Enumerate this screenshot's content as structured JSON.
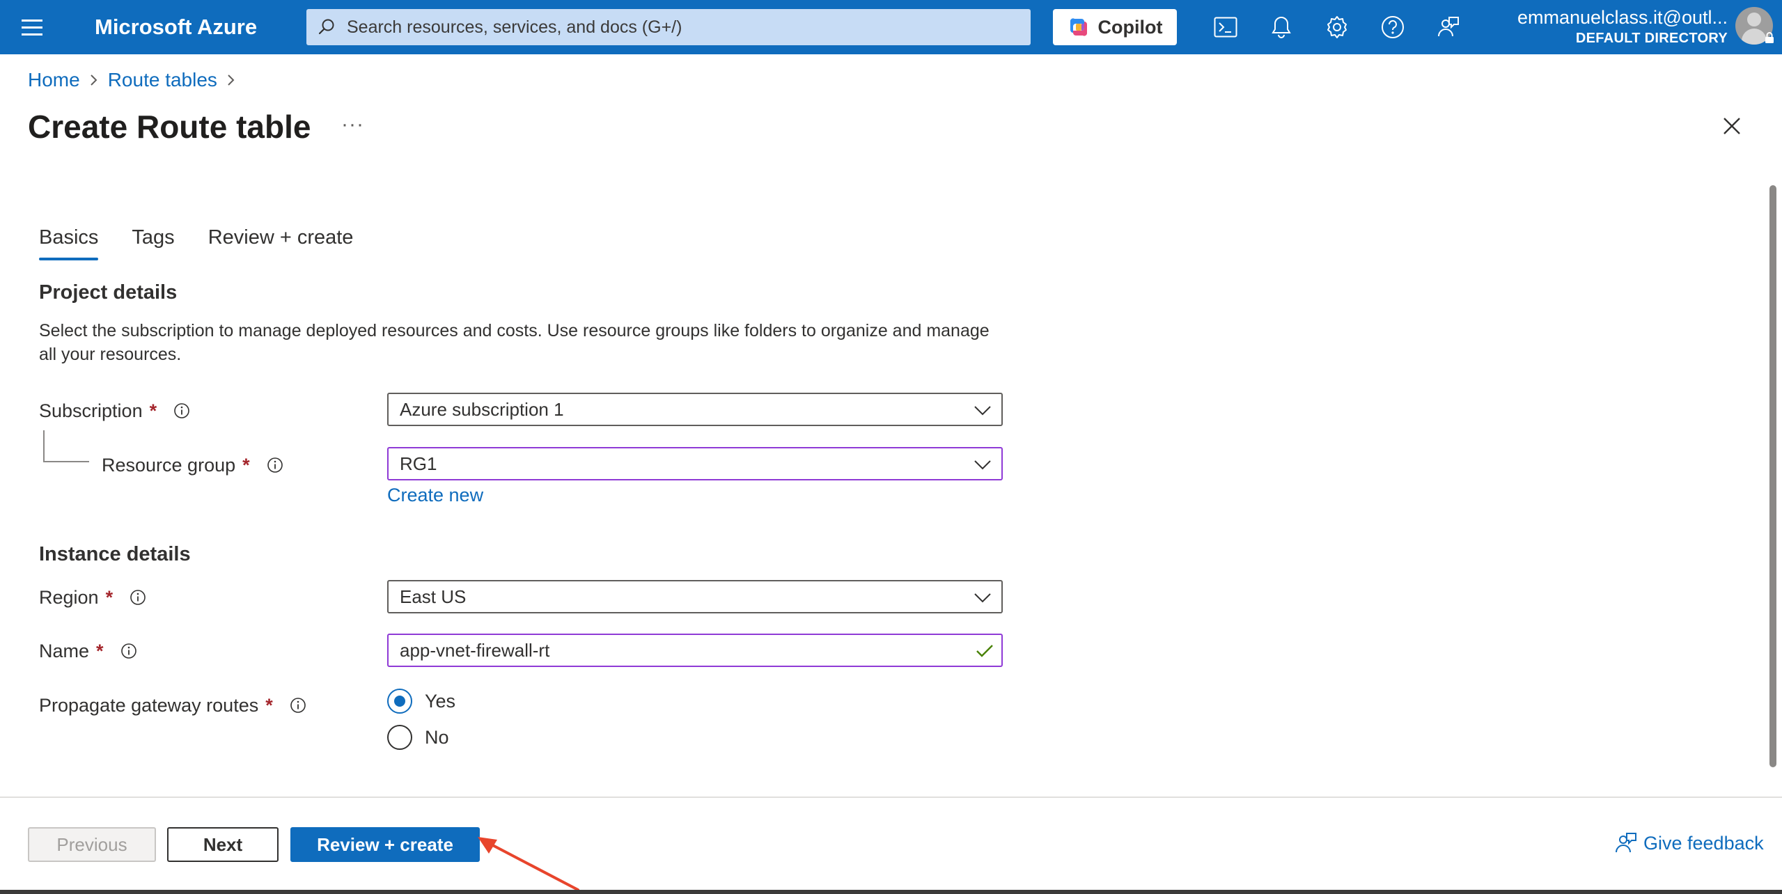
{
  "topbar": {
    "brand": "Microsoft Azure",
    "search_placeholder": "Search resources, services, and docs (G+/)",
    "copilot_label": "Copilot",
    "account_email": "emmanuelclass.it@outl...",
    "account_directory": "DEFAULT DIRECTORY",
    "icons": [
      "hamburger-icon",
      "search-icon",
      "copilot-icon",
      "cloud-shell-icon",
      "notifications-icon",
      "settings-icon",
      "help-icon",
      "feedback-icon",
      "avatar"
    ]
  },
  "breadcrumb": {
    "items": [
      "Home",
      "Route tables"
    ]
  },
  "page": {
    "title": "Create Route table",
    "more": "···"
  },
  "tabs": [
    "Basics",
    "Tags",
    "Review + create"
  ],
  "project": {
    "heading": "Project details",
    "description": "Select the subscription to manage deployed resources and costs. Use resource groups like folders to organize and manage all your resources.",
    "subscription_label": "Subscription",
    "subscription_value": "Azure subscription 1",
    "resource_group_label": "Resource group",
    "resource_group_value": "RG1",
    "create_new": "Create new"
  },
  "instance": {
    "heading": "Instance details",
    "region_label": "Region",
    "region_value": "East US",
    "name_label": "Name",
    "name_value": "app-vnet-firewall-rt",
    "propagate_label": "Propagate gateway routes",
    "options": [
      "Yes",
      "No"
    ],
    "selected": "Yes"
  },
  "required_mark": "*",
  "footer": {
    "previous": "Previous",
    "next": "Next",
    "review_create": "Review + create",
    "give_feedback": "Give feedback"
  },
  "colors": {
    "accent": "#0f6cbd",
    "required": "#a4262c",
    "focus_border": "#8f3ad6",
    "valid_check": "#498205",
    "annotation_arrow": "#e8452c"
  }
}
